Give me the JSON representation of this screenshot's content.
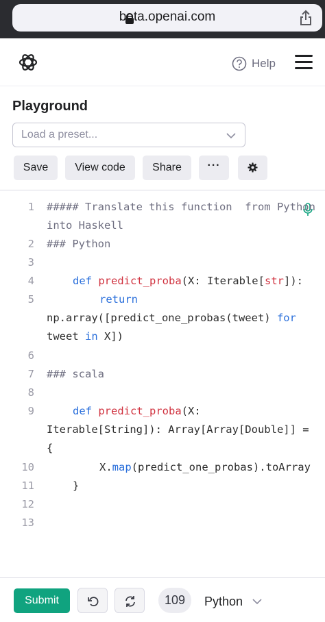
{
  "browser": {
    "url": "beta.openai.com",
    "lock_icon": "lock-icon",
    "share_icon": "share-icon"
  },
  "header": {
    "logo_icon": "openai-logo-icon",
    "help_label": "Help",
    "help_icon": "help-circle-icon",
    "menu_icon": "hamburger-menu-icon"
  },
  "page": {
    "title": "Playground"
  },
  "preset": {
    "placeholder": "Load a preset...",
    "icon": "chevron-down-icon"
  },
  "toolbar": {
    "save_label": "Save",
    "view_code_label": "View code",
    "share_label": "Share",
    "more_label": "···",
    "settings_icon": "gear-icon"
  },
  "editor": {
    "mic_icon": "microphone-icon",
    "line_numbers": [
      "1",
      "2",
      "3",
      "4",
      "5",
      "6",
      "7",
      "8",
      "9",
      "10",
      "11",
      "12",
      "13"
    ],
    "lines": [
      "##### Translate this function  from Python",
      "into Haskell",
      "### Python",
      "def",
      " predict_proba",
      "(X: Iterable[",
      "str",
      "]):",
      "return",
      "np.array([predict_one_probas(tweet) ",
      "for",
      "tweet ",
      "in",
      " X])",
      "### scala",
      "def",
      " predict_proba",
      "(X:",
      "Iterable[String]): Array[Array[Double]] =",
      "{",
      "X.",
      "map",
      "(predict_one_probas).toArray",
      "}"
    ]
  },
  "footer": {
    "submit_label": "Submit",
    "undo_icon": "undo-icon",
    "regenerate_icon": "regenerate-icon",
    "token_count": "109",
    "language": "Python",
    "language_icon": "chevron-down-icon"
  },
  "colors": {
    "accent": "#10a37f",
    "keyword": "#2a6fdb",
    "function": "#d0323f",
    "comment": "#6e6e80"
  }
}
